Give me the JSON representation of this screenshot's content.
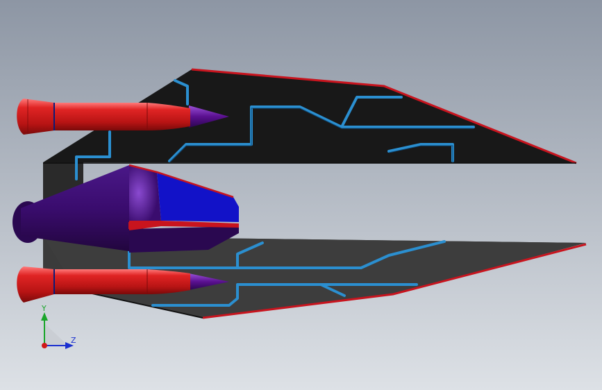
{
  "viewport": {
    "background_top": "#8d96a4",
    "background_bottom": "#dde1e6"
  },
  "model": {
    "colors": {
      "panel_dark": "#181818",
      "panel_gray": "#3b3b3b",
      "edge_red": "#c8141e",
      "tube_blue": "#2b8fd0",
      "body_purple": "#3a0c6e",
      "body_blue": "#1212c8",
      "pod_red": "#d01818",
      "tip_violet": "#5a1090"
    }
  },
  "triad": {
    "y_label": "Y",
    "z_label": "Z",
    "y_color": "#1aa52a",
    "z_color": "#1a2fd0",
    "x_color": "#d01818"
  }
}
